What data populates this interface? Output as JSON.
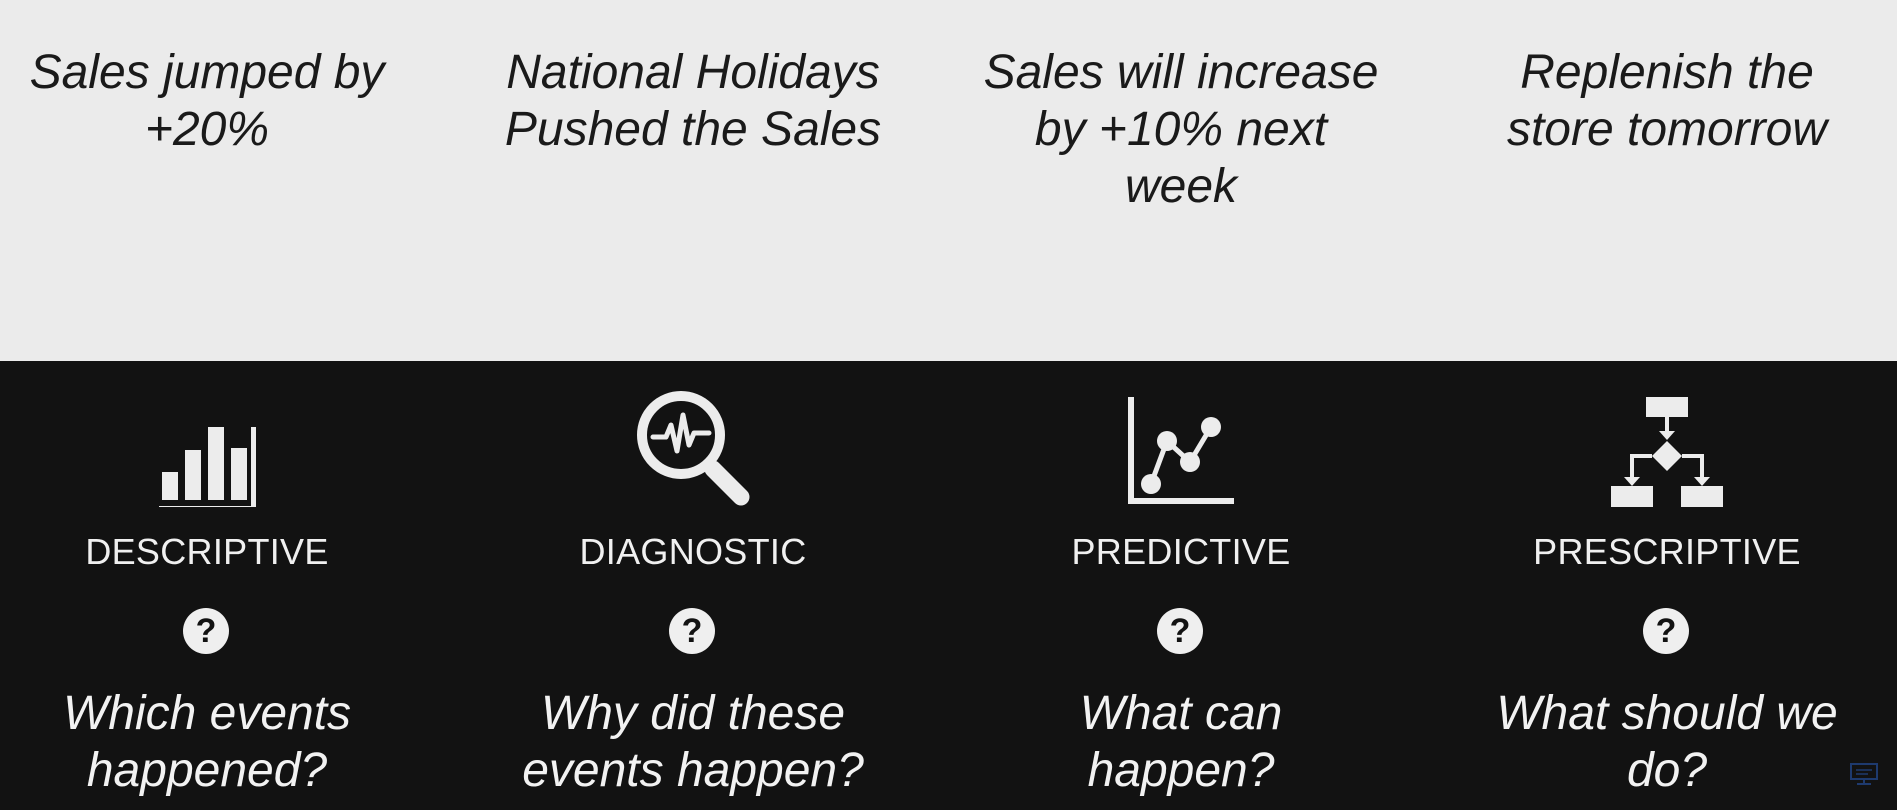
{
  "columns": [
    {
      "answer": "Sales jumped by\n+20%",
      "type": "DESCRIPTIVE",
      "icon": "bar-chart-icon",
      "qmark": "?",
      "question": "Which events\nhappened?"
    },
    {
      "answer": "National Holidays\nPushed the Sales",
      "type": "DIAGNOSTIC",
      "icon": "magnifier-pulse-icon",
      "qmark": "?",
      "question": "Why did these\nevents happen?"
    },
    {
      "answer": "Sales will increase\nby +10% next\nweek",
      "type": "PREDICTIVE",
      "icon": "line-chart-icon",
      "qmark": "?",
      "question": "What can\nhappen?"
    },
    {
      "answer": "Replenish the\nstore tomorrow",
      "type": "PRESCRIPTIVE",
      "icon": "flowchart-icon",
      "qmark": "?",
      "question": "What should we\ndo?"
    }
  ],
  "colors": {
    "top_background": "#ebebeb",
    "bottom_background": "#121212",
    "icon": "#ececec",
    "corner_icon": "#1e3a6e"
  }
}
